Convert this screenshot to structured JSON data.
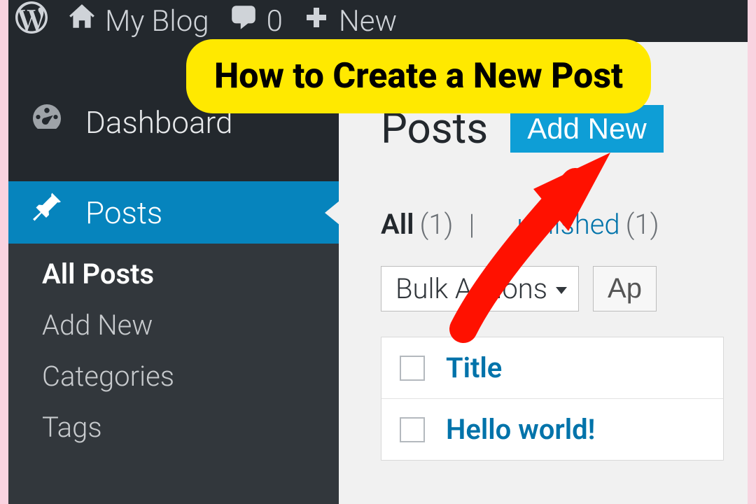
{
  "topbar": {
    "site_name": "My Blog",
    "comment_count": "0",
    "new_label": "New"
  },
  "sidebar": {
    "dashboard": "Dashboard",
    "posts": "Posts",
    "submenu": {
      "all_posts": "All Posts",
      "add_new": "Add New",
      "categories": "Categories",
      "tags": "Tags"
    }
  },
  "content": {
    "page_title": "Posts",
    "add_new_btn": "Add New",
    "filters": {
      "all_label": "All",
      "all_count": "(1)",
      "divider": "|",
      "published_label": "ublished",
      "published_count": "(1)"
    },
    "bulk_actions": "Bulk Actions",
    "apply_btn": "Ap",
    "table": {
      "header_title": "Title",
      "row1_title": "Hello world!"
    }
  },
  "callout": "How to Create a New Post"
}
